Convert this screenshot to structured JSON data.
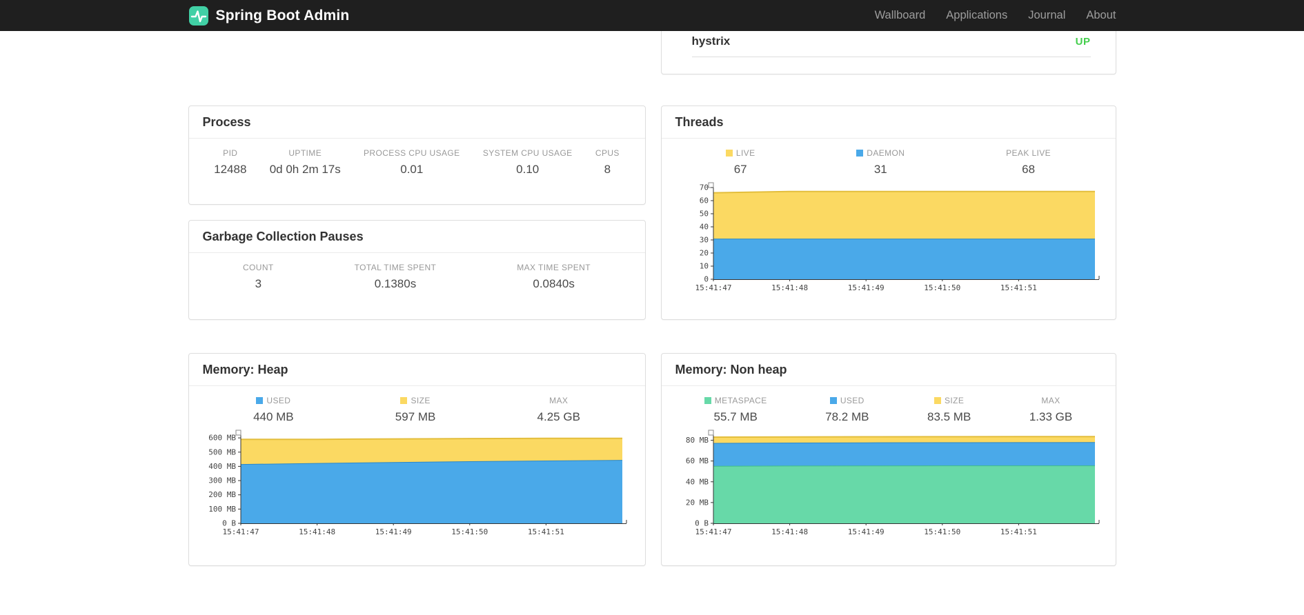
{
  "navbar": {
    "brand": "Spring Boot Admin",
    "items": [
      "Wallboard",
      "Applications",
      "Journal",
      "About"
    ]
  },
  "application_panel": {
    "name": "hystrix",
    "status": "UP"
  },
  "panels": {
    "process": {
      "title": "Process",
      "stats": [
        {
          "label": "PID",
          "value": "12488"
        },
        {
          "label": "UPTIME",
          "value": "0d 0h 2m 17s"
        },
        {
          "label": "PROCESS CPU USAGE",
          "value": "0.01"
        },
        {
          "label": "SYSTEM CPU USAGE",
          "value": "0.10"
        },
        {
          "label": "CPUS",
          "value": "8"
        }
      ]
    },
    "gc": {
      "title": "Garbage Collection Pauses",
      "stats": [
        {
          "label": "COUNT",
          "value": "3"
        },
        {
          "label": "TOTAL TIME SPENT",
          "value": "0.1380s"
        },
        {
          "label": "MAX TIME SPENT",
          "value": "0.0840s"
        }
      ]
    },
    "threads": {
      "title": "Threads",
      "stats": [
        {
          "label": "LIVE",
          "value": "67",
          "swatch": "#FBD962"
        },
        {
          "label": "DAEMON",
          "value": "31",
          "swatch": "#4AA9E9"
        },
        {
          "label": "PEAK LIVE",
          "value": "68"
        }
      ]
    },
    "memory_heap": {
      "title": "Memory: Heap",
      "stats": [
        {
          "label": "USED",
          "value": "440 MB",
          "swatch": "#4AA9E9"
        },
        {
          "label": "SIZE",
          "value": "597 MB",
          "swatch": "#FBD962"
        },
        {
          "label": "MAX",
          "value": "4.25 GB"
        }
      ]
    },
    "memory_nonheap": {
      "title": "Memory: Non heap",
      "stats": [
        {
          "label": "METASPACE",
          "value": "55.7 MB",
          "swatch": "#67D9A8"
        },
        {
          "label": "USED",
          "value": "78.2 MB",
          "swatch": "#4AA9E9"
        },
        {
          "label": "SIZE",
          "value": "83.5 MB",
          "swatch": "#FBD962"
        },
        {
          "label": "MAX",
          "value": "1.33 GB"
        }
      ]
    }
  },
  "colors": {
    "brand_teal": "#41D0A5",
    "status_up_green": "#43CE4C",
    "live_yellow": "#FBD962",
    "daemon_blue": "#4AA9E9",
    "metaspace_green": "#67D9A8"
  },
  "chart_data": [
    {
      "id": "threads",
      "type": "area",
      "title": "Threads",
      "x_labels": [
        "15:41:47",
        "15:41:48",
        "15:41:49",
        "15:41:50",
        "15:41:51"
      ],
      "ylim": [
        0,
        70
      ],
      "y_ticks": [
        {
          "value": 0,
          "label": "0"
        },
        {
          "value": 10,
          "label": "10"
        },
        {
          "value": 20,
          "label": "20"
        },
        {
          "value": 30,
          "label": "30"
        },
        {
          "value": 40,
          "label": "40"
        },
        {
          "value": 50,
          "label": "50"
        },
        {
          "value": 60,
          "label": "60"
        },
        {
          "value": 70,
          "label": "70"
        }
      ],
      "series": [
        {
          "name": "DAEMON",
          "fill": "#4AA9E9",
          "stroke": "#2B87C8",
          "tops": [
            31,
            31,
            31,
            31,
            31,
            31
          ]
        },
        {
          "name": "LIVE",
          "fill": "#FBD962",
          "stroke": "#E3BE3D",
          "tops": [
            66,
            67,
            67,
            67,
            67,
            67
          ]
        }
      ],
      "grid": false,
      "legend_position": "top"
    },
    {
      "id": "memory_heap",
      "type": "area",
      "title": "Memory: Heap",
      "x_labels": [
        "15:41:47",
        "15:41:48",
        "15:41:49",
        "15:41:50",
        "15:41:51"
      ],
      "ylim": [
        0,
        620
      ],
      "y_ticks": [
        {
          "value": 0,
          "label": "0 B"
        },
        {
          "value": 100,
          "label": "100 MB"
        },
        {
          "value": 200,
          "label": "200 MB"
        },
        {
          "value": 300,
          "label": "300 MB"
        },
        {
          "value": 400,
          "label": "400 MB"
        },
        {
          "value": 500,
          "label": "500 MB"
        },
        {
          "value": 600,
          "label": "600 MB"
        }
      ],
      "series": [
        {
          "name": "USED",
          "fill": "#4AA9E9",
          "stroke": "#2B87C8",
          "tops": [
            416,
            423,
            430,
            436,
            441,
            445
          ]
        },
        {
          "name": "SIZE",
          "fill": "#FBD962",
          "stroke": "#E3BE3D",
          "tops": [
            590,
            590,
            593,
            595,
            597,
            597
          ]
        }
      ],
      "grid": false,
      "legend_position": "top"
    },
    {
      "id": "memory_nonheap",
      "type": "area",
      "title": "Memory: Non heap",
      "x_labels": [
        "15:41:47",
        "15:41:48",
        "15:41:49",
        "15:41:50",
        "15:41:51"
      ],
      "ylim": [
        0,
        85
      ],
      "y_ticks": [
        {
          "value": 0,
          "label": "0 B"
        },
        {
          "value": 20,
          "label": "20 MB"
        },
        {
          "value": 40,
          "label": "40 MB"
        },
        {
          "value": 60,
          "label": "60 MB"
        },
        {
          "value": 80,
          "label": "80 MB"
        }
      ],
      "series": [
        {
          "name": "METASPACE",
          "fill": "#67D9A8",
          "stroke": "#41BE89",
          "tops": [
            55.3,
            55.5,
            55.6,
            55.7,
            55.7,
            55.7
          ]
        },
        {
          "name": "USED",
          "fill": "#4AA9E9",
          "stroke": "#2B87C8",
          "tops": [
            77.4,
            77.7,
            77.9,
            78.0,
            78.1,
            78.2
          ]
        },
        {
          "name": "SIZE",
          "fill": "#FBD962",
          "stroke": "#E3BE3D",
          "tops": [
            83.0,
            83.2,
            83.3,
            83.4,
            83.5,
            83.5
          ]
        }
      ],
      "grid": false,
      "legend_position": "top"
    }
  ]
}
